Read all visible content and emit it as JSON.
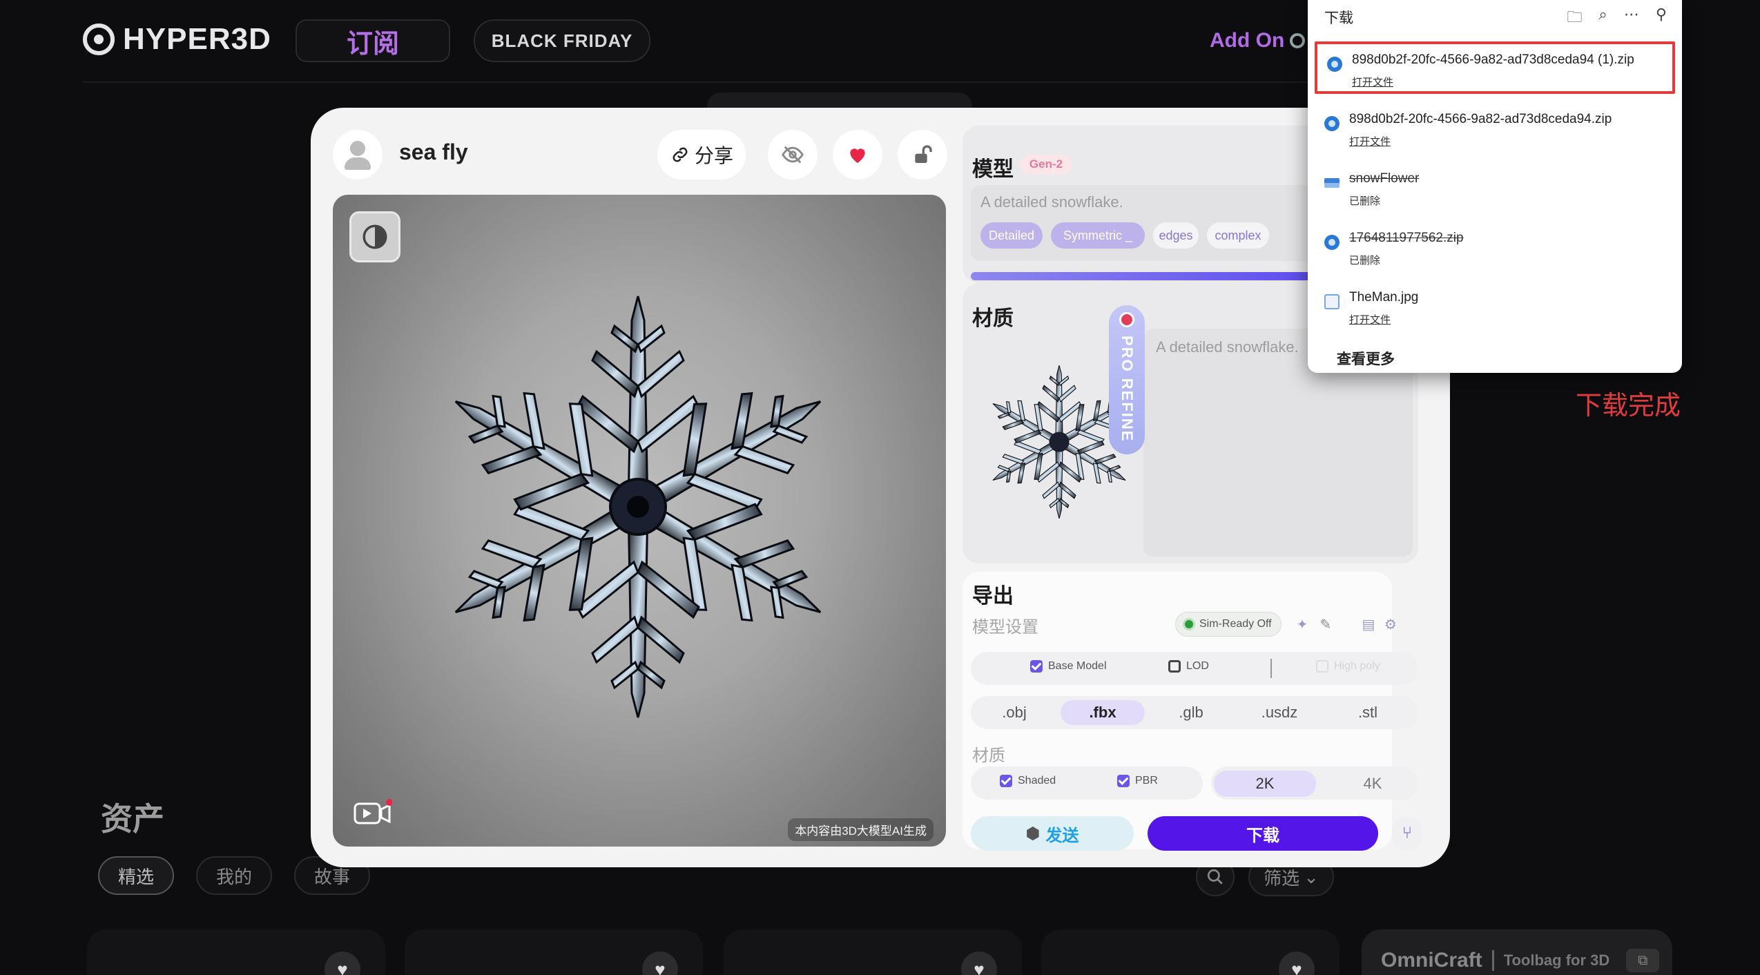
{
  "topnav": {
    "logo_text": "HYPER3D",
    "subscribe_label": "订阅",
    "black_friday_label": "BLACK FRIDAY",
    "addon_label": "Add On"
  },
  "modal": {
    "username": "sea fly",
    "share_label": "分享",
    "viewer_caption": "本内容由3D大模型AI生成",
    "model_panel": {
      "title": "模型",
      "badge": "Gen-2",
      "prompt": "A detailed snowflake.",
      "tags": [
        {
          "label": "Detailed",
          "active": true
        },
        {
          "label": "Symmetric _",
          "active": true
        },
        {
          "label": "edges",
          "active": false
        },
        {
          "label": "complex",
          "active": false
        }
      ]
    },
    "material_panel": {
      "title": "材质",
      "prompt": "A detailed snowflake."
    },
    "pro_refine": "PRO REFINE",
    "export": {
      "title": "导出",
      "model_settings_label": "模型设置",
      "sim_ready": "Sim-Ready Off",
      "base_model": {
        "label": "Base Model",
        "checked": true
      },
      "lod": {
        "label": "LOD",
        "checked": false
      },
      "high_poly": "High poly",
      "formats": [
        ".obj",
        ".fbx",
        ".glb",
        ".usdz",
        ".stl"
      ],
      "selected_format": ".fbx",
      "material_label": "材质",
      "shaded": {
        "label": "Shaded",
        "checked": true
      },
      "pbr": {
        "label": "PBR",
        "checked": true
      },
      "resolutions": [
        "2K",
        "4K"
      ],
      "selected_resolution": "2K",
      "send_label": "发送",
      "download_label": "下载"
    }
  },
  "background": {
    "assets_title": "资产",
    "tabs": [
      "精选",
      "我的",
      "故事"
    ],
    "filter_label": "筛选",
    "omnicraft_name": "OmniCraft",
    "omnicraft_sub": "Toolbag for 3D"
  },
  "downloads": {
    "title": "下载",
    "items": [
      {
        "name": "898d0b2f-20fc-4566-9a82-ad73d8ceda94 (1).zip",
        "status": "打开文件",
        "icon": "zip-icon",
        "deleted": false,
        "highlight": true
      },
      {
        "name": "898d0b2f-20fc-4566-9a82-ad73d8ceda94.zip",
        "status": "打开文件",
        "icon": "zip-icon",
        "deleted": false,
        "highlight": false
      },
      {
        "name": "snowFlower",
        "status": "已删除",
        "icon": "file-icon",
        "deleted": true,
        "highlight": false
      },
      {
        "name": "1764811977562.zip",
        "status": "已删除",
        "icon": "zip-icon",
        "deleted": true,
        "highlight": false
      },
      {
        "name": "TheMan.jpg",
        "status": "打开文件",
        "icon": "image-file-icon",
        "deleted": false,
        "highlight": false
      }
    ],
    "see_more": "查看更多"
  },
  "annotation": "下载完成",
  "colors": {
    "accent_purple": "#5415e8",
    "subscribe_purple": "#b46ee6",
    "highlight_red": "#e23b3b",
    "like_red": "#e8264a"
  }
}
